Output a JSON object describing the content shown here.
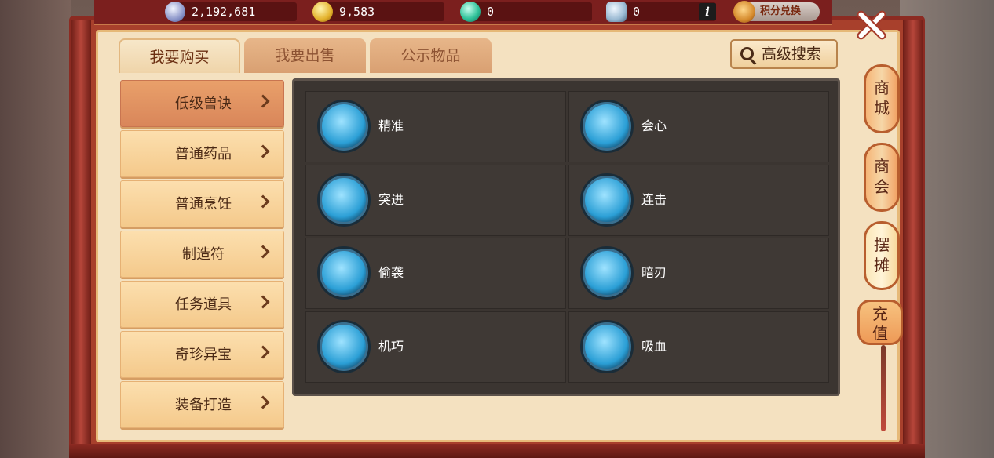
{
  "currencies": {
    "silver": "2,192,681",
    "gold": "9,583",
    "jade": "0",
    "tickets": "0"
  },
  "header": {
    "info_label": "i",
    "exchange_label": "积分兑换"
  },
  "tabs": [
    {
      "label": "我要购买",
      "active": true
    },
    {
      "label": "我要出售",
      "active": false
    },
    {
      "label": "公示物品",
      "active": false
    }
  ],
  "search": {
    "label": "高级搜索"
  },
  "categories": [
    {
      "label": "低级兽诀",
      "active": true
    },
    {
      "label": "普通药品",
      "active": false
    },
    {
      "label": "普通烹饪",
      "active": false
    },
    {
      "label": "制造符",
      "active": false
    },
    {
      "label": "任务道具",
      "active": false
    },
    {
      "label": "奇珍异宝",
      "active": false
    },
    {
      "label": "装备打造",
      "active": false
    }
  ],
  "skills": [
    {
      "name": "精准",
      "icon": "spear-icon"
    },
    {
      "name": "会心",
      "icon": "blade-icon"
    },
    {
      "name": "突进",
      "icon": "beast-dash-icon"
    },
    {
      "name": "连击",
      "icon": "combo-strike-icon"
    },
    {
      "name": "偷袭",
      "icon": "ambush-icon"
    },
    {
      "name": "暗刃",
      "icon": "dark-blade-icon"
    },
    {
      "name": "机巧",
      "icon": "fist-icon"
    },
    {
      "name": "吸血",
      "icon": "fangs-icon"
    }
  ],
  "side_menu": {
    "shop": [
      "商",
      "城"
    ],
    "guild": [
      "商",
      "会"
    ],
    "stall": [
      "摆",
      "摊"
    ],
    "recharge": [
      "充",
      "值"
    ]
  }
}
